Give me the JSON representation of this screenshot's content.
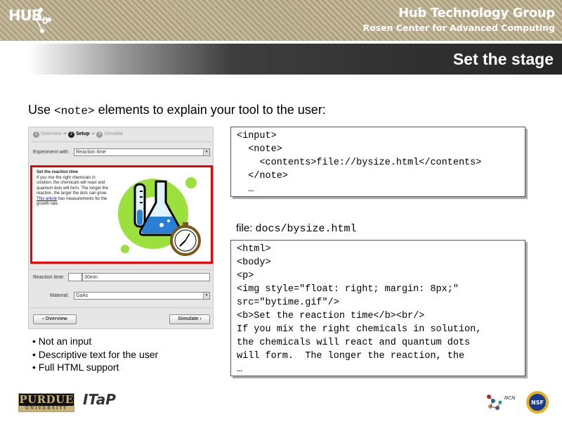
{
  "header": {
    "logo_text": "HUB",
    "logo_sub": "0",
    "org_name": "Hub Technology Group",
    "org_sub": "Rosen Center for Advanced Computing"
  },
  "slide": {
    "title": "Set the stage",
    "intro_before": "Use ",
    "intro_code": "<note>",
    "intro_after": " elements to explain your tool to the user:",
    "file_label": "file:",
    "file_path": "docs/bysize.html"
  },
  "screenshot": {
    "steps": [
      {
        "num": "1",
        "label": "Overview"
      },
      {
        "num": "2",
        "label": "Setup"
      },
      {
        "num": "3",
        "label": "Simulate"
      }
    ],
    "experiment_label": "Experiment with:",
    "experiment_value": "Reaction time",
    "note_title": "Set the reaction time",
    "note_body": "If you mix the right chemicals in solution, the chemicals will react and quantum dots will form. The longer the reaction, the larger the dots can grow.",
    "note_link": "This article",
    "note_tail": " has measurements for the growth rate.",
    "reaction_label": "Reaction time:",
    "reaction_value": "30min",
    "material_label": "Material:",
    "material_value": "GaAs",
    "overview_button": "‹ Overview",
    "simulate_button": "Simulate ›"
  },
  "bullets": [
    "Not an input",
    "Descriptive text for the user",
    "Full HTML support"
  ],
  "code_xml": [
    "<input>",
    "  <note>",
    "    <contents>file://bysize.html</contents>",
    "  </note>",
    "  …"
  ],
  "code_html": [
    "<html>",
    "<body>",
    "<p>",
    "<img style=\"float: right; margin: 8px;\"",
    "src=\"bytime.gif\"/>",
    "<b>Set the reaction time</b><br/>",
    "If you mix the right chemicals in solution,",
    "the chemicals will react and quantum dots",
    "will form.  The longer the reaction, the",
    "…"
  ],
  "footer": {
    "purdue_top": "PURDUE",
    "purdue_bottom": "UNIVERSITY",
    "itap": "ITaP",
    "ncn": "NCN",
    "nsf": "NSF"
  },
  "colors": {
    "banner": "#b9ad90",
    "title_bar": "#262626",
    "highlight_border": "#e00000",
    "flask_green": "#9be03c",
    "flask_blue": "#2a7fd4"
  }
}
